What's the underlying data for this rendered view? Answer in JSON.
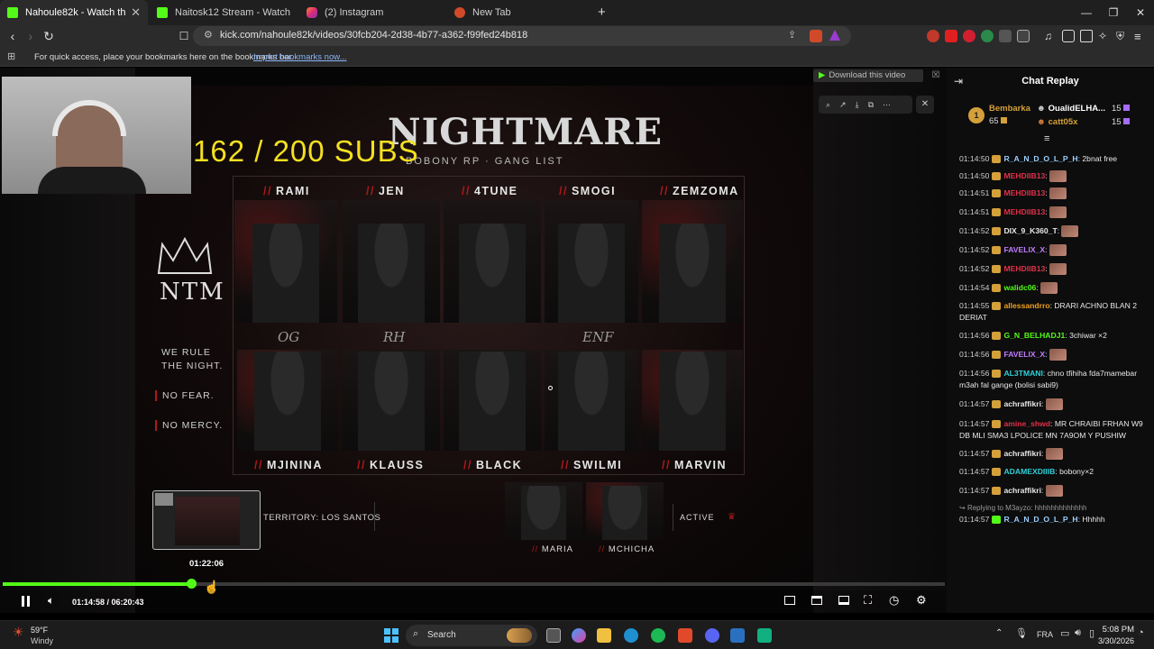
{
  "browser": {
    "tabs": [
      {
        "title": "Nahoule82k - Watch the VOD",
        "active": true
      },
      {
        "title": "Naitosk12 Stream - Watch Live on Ki"
      },
      {
        "title": "(2) Instagram"
      },
      {
        "title": "New Tab"
      }
    ],
    "new_tab": "+",
    "url": "kick.com/nahoule82k/videos/30fcb204-2d38-4b77-a362-f99fed24b818",
    "bookmarks_hint": "For quick access, place your bookmarks here on the bookmarks bar.",
    "bookmarks_link": "Import bookmarks now..."
  },
  "video": {
    "subs_overlay": "162 / 200  SUBS",
    "download_button": "Download this video",
    "poster": {
      "title": "NIGHTMARE",
      "subtitle": "BOBONY RP · GANG LIST",
      "logo": "NTM",
      "slogan": [
        "WE RULE",
        "THE NIGHT.",
        "NO FEAR.",
        "NO MERCY."
      ],
      "top_members": [
        "RAMI",
        "JEN",
        "4TUNE",
        "SMOGI",
        "ZEMZOMA"
      ],
      "tags": [
        "OG",
        "RH",
        "ENF"
      ],
      "bottom_members": [
        "MJININA",
        "KLAUSS",
        "BLACK",
        "SWILMI",
        "MARVIN"
      ],
      "territory": "TERRITORY: LOS SANTOS",
      "status": "ACTIVE",
      "extra_members": [
        "MARIA",
        "MCHICHA"
      ]
    },
    "progress": 0.2,
    "hover_time": "01:22:06",
    "current_time": "01:14:58",
    "duration": "06:20:43",
    "time_display": "01:14:58 / 06:20:43"
  },
  "chat": {
    "title": "Chat Replay",
    "leaderboard": [
      {
        "rank": "1",
        "name": "Bembarka",
        "value": "65"
      },
      {
        "name": "OualidELHA...",
        "value": "15"
      },
      {
        "name": "catt05x",
        "value": "15"
      }
    ],
    "messages": [
      {
        "time": "01:14:50",
        "user": "R_A_N_D_O_L_P_H",
        "text": "2bnat free",
        "color": "#9ad0ff"
      },
      {
        "time": "01:14:50",
        "user": "MEHDIIB13",
        "text": "",
        "color": "#e0304a",
        "emote": true
      },
      {
        "time": "01:14:51",
        "user": "MEHDIIB13",
        "text": "",
        "color": "#e0304a",
        "emote": true
      },
      {
        "time": "01:14:51",
        "user": "MEHDIIB13",
        "text": "",
        "color": "#e0304a",
        "emote": true
      },
      {
        "time": "01:14:52",
        "user": "DIX_9_K360_T",
        "text": "",
        "color": "#e8e8e8",
        "emote": true
      },
      {
        "time": "01:14:52",
        "user": "FAVELIX_X",
        "text": "",
        "color": "#c07cff",
        "emote": true
      },
      {
        "time": "01:14:52",
        "user": "MEHDIIB13",
        "text": "",
        "color": "#e0304a",
        "emote": true
      },
      {
        "time": "01:14:54",
        "user": "walidc06",
        "text": "",
        "color": "#53fc18",
        "emote": true
      },
      {
        "time": "01:14:55",
        "user": "allessandrro",
        "text": "DRARI ACHNO BLAN 2 DERIAT",
        "color": "#f0a020"
      },
      {
        "time": "01:14:56",
        "user": "G_N_BELHADJ1",
        "text": "3chiwar ×2",
        "color": "#53fc18"
      },
      {
        "time": "01:14:56",
        "user": "FAVELIX_X",
        "text": "",
        "color": "#c07cff",
        "emote": true
      },
      {
        "time": "01:14:56",
        "user": "AL3TMANI",
        "text": "chno tfihiha fda7mamebar m3ah fal gange (bolisi sabi9)",
        "color": "#30d0d8"
      },
      {
        "time": "01:14:57",
        "user": "achraffikri",
        "text": "",
        "color": "#e8e8e8",
        "emote": true
      },
      {
        "time": "01:14:57",
        "user": "amine_shwd",
        "text": "MR CHRAIBI FRHAN W9 DB MLI SMA3 LPOLICE MN 7A9OM Y PUSHIW",
        "color": "#e0304a"
      },
      {
        "time": "01:14:57",
        "user": "achraffikri",
        "text": "",
        "color": "#e8e8e8",
        "emote": true
      },
      {
        "time": "01:14:57",
        "user": "ADAMEXDIIIB",
        "text": "bobony×2",
        "color": "#30d0d8"
      },
      {
        "time": "01:14:57",
        "user": "achraffikri",
        "text": "",
        "color": "#e8e8e8",
        "emote": true
      }
    ],
    "reply_note": "Replying to M3ayzo: hhhhhhhhhhhhh",
    "last_message": {
      "time": "01:14:57",
      "user": "R_A_N_D_O_L_P_H",
      "text": "Hhhhh"
    }
  },
  "taskbar": {
    "weather_temp": "59°F",
    "weather_desc": "Windy",
    "search": "Search",
    "lang": "FRA",
    "time": "5:08 PM",
    "date": "3/30/2026"
  },
  "colors": {
    "kick_green": "#53fc18",
    "subs_yellow": "#f5e020",
    "poster_red": "#b01818"
  }
}
